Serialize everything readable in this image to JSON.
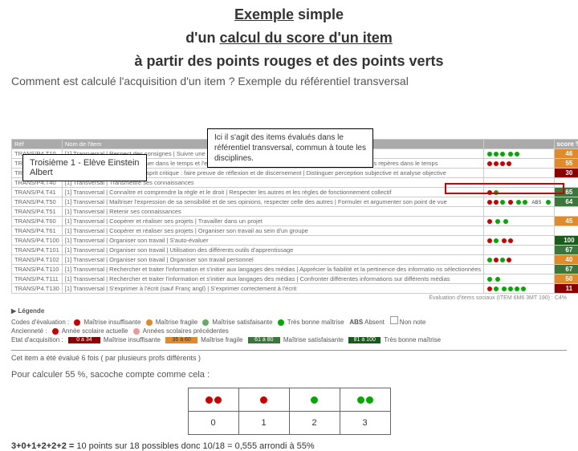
{
  "title": {
    "line1a": "Exemple",
    "line1b": " simple",
    "line2a": "d'un ",
    "line2b": "calcul du score d'un item",
    "line3": "à partir des points rouges et des points verts"
  },
  "subtitle": "Comment est calculé l'acquisition d'un item ? Exemple du référentiel transversal",
  "callout_left_l1": "Troisième 1 - Elève Einstein",
  "callout_left_l2": "Albert",
  "callout_right_l1": "Ici il s'agit des items évalués dans le",
  "callout_right_l2": "référentiel transversal, commun à toute les",
  "callout_right_l3": "disciplines.",
  "headers": {
    "ref": "Réf",
    "name": "Nom de l'item",
    "score": "score %"
  },
  "rows": [
    {
      "ref": "TRANS/P4.T10",
      "name": "[1] Transversal | Respect des consignes | Suivre une consigne (orale ou écrite)",
      "dots": "ggg gg",
      "score": 46,
      "cls": "bg-ora"
    },
    {
      "ref": "TRANS/P4.T20",
      "name": "[1] Transversal | Vivre et se situer dans le temps et l'espace N. 1, 2, 3a,3b-5,6,7 | Maîtriser de manière autonome des repères dans le temps",
      "dots": "rrrr",
      "score": 55,
      "cls": "bg-ora"
    },
    {
      "ref": "TRANS/P4.T30",
      "name": "[1] Transversal | Exercer son esprit critique : faire preuve de réflexion et de discernement | Distinguer perception subjective et analyse objective",
      "dots": "",
      "score": 30,
      "cls": "bg-dred"
    },
    {
      "ref": "TRANS/P4.T40",
      "name": "[1] Transversal | Transmettre ses connaissances",
      "dots": "",
      "score": "",
      "cls": ""
    },
    {
      "ref": "TRANS/P4.T41",
      "name": "[1] Transversal | Connaître et comprendre la règle et le droit | Respecter les autres et les règles de fonctionnement collectif",
      "dots": "rg",
      "score": 65,
      "cls": "bg-grn"
    },
    {
      "ref": "TRANS/P4.T50",
      "name": "[1] Transversal | Maîtriser l'expression de sa sensibilité et de ses opinions, respecter celle des autres | Formuler et argumenter son point de vue",
      "dots": "rrg r gg a g",
      "score": 64,
      "cls": "bg-grn"
    },
    {
      "ref": "TRANS/P4.T51",
      "name": "[1] Transversal | Retenir ses connaissances",
      "dots": "",
      "score": "",
      "cls": ""
    },
    {
      "ref": "TRANS/P4.T60",
      "name": "[1] Transversal | Coopérer et réaliser ses projets | Travailler dans un projet",
      "dots": "r g g",
      "score": 45,
      "cls": "bg-ora"
    },
    {
      "ref": "TRANS/P4.T61",
      "name": "[1] Transversal | Coopérer et réaliser ses projets | Organiser son travail au sein d'un groupe",
      "dots": "",
      "score": "",
      "cls": ""
    },
    {
      "ref": "TRANS/P4.T100",
      "name": "[1] Transversal | Organiser son travail | S'auto-évaluer",
      "dots": "rg rr",
      "score": 100,
      "cls": "bg-dgr"
    },
    {
      "ref": "TRANS/P4.T101",
      "name": "[1] Transversal | Organiser son travail | Utilisation des différents outils d'apprentissage",
      "dots": "",
      "score": 67,
      "cls": "bg-grn"
    },
    {
      "ref": "TRANS/P4.T102",
      "name": "[1] Transversal | Organiser son travail | Organiser son travail personnel",
      "dots": "grgr",
      "score": 40,
      "cls": "bg-ora"
    },
    {
      "ref": "TRANS/P4.T110",
      "name": "[1] Transversal | Rechercher et traiter l'information et s'initier aux langages des médias | Apprécier la fiabilité et la pertinence des informatio ns sélectionnées",
      "dots": "",
      "score": 67,
      "cls": "bg-grn"
    },
    {
      "ref": "TRANS/P4.T111",
      "name": "[1] Transversal | Rechercher et traiter l'information et s'initier aux langages des médias | Confronter différentes informations sur différents médias",
      "dots": "g g",
      "score": 50,
      "cls": "bg-ora"
    },
    {
      "ref": "TRANS/P4.T130",
      "name": "[1] Transversal | S'exprimer à l'écrit (sauf Franç angl) | S'exprimer correctement à l'écrit",
      "dots": "rg gggg",
      "score": 11,
      "cls": "bg-dred"
    }
  ],
  "source_line": "Évaluation d'items sociaux (ITEM 6M6 3MT 190) : C4%",
  "legend": {
    "title": "▶ Légende",
    "codes": "Codes d'évaluation :",
    "c1": "Maîtrise insuffisante",
    "c2": "Maîtrise fragile",
    "c3": "Maîtrise satisfaisante",
    "c4": "Très bonne maîtrise",
    "abs": "ABS",
    "abs_label": "Absent",
    "nn": "Non note",
    "anc": "Ancienneté :",
    "a1": "Année scolaire actuelle",
    "a2": "Années scolaires précédentes",
    "etat": "Etat d'acquisition :",
    "e1r": "0 à 34",
    "e1l": "Maîtrise insuffisante",
    "e2r": "35 à 60",
    "e2l": "Maîtrise fragile",
    "e3r": "61 à 80",
    "e3l": "Maîtrise satisfaisante",
    "e4r": "81 à 100",
    "e4l": "Très bonne maîtrise"
  },
  "note": "Cet item a été évalué 6 fois ( par plusieurs profs différents )",
  "calc_intro": "Pour calculer 55 %, sacoche compte comme cela :",
  "calc_headers": [
    "0",
    "1",
    "2",
    "3"
  ],
  "formula_lhs": "3+0+1+2+2+2 = ",
  "formula_rhs": "10  points sur 18  possibles donc 10/18 = 0,555 arrondi à 55%"
}
